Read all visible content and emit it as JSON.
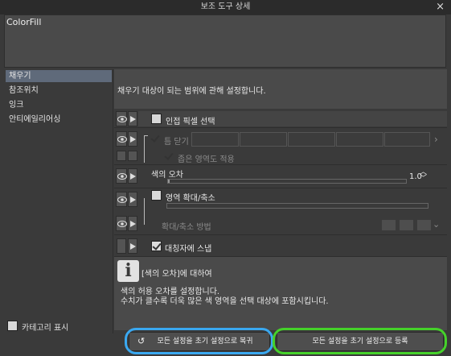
{
  "window": {
    "title": "보조 도구 상세",
    "close_label": "×"
  },
  "tool_name": "ColorFill",
  "categories": [
    {
      "label": "채우기",
      "selected": true
    },
    {
      "label": "참조위치",
      "selected": false
    },
    {
      "label": "잉크",
      "selected": false
    },
    {
      "label": "안티에일리어싱",
      "selected": false
    }
  ],
  "category_display_label": "카테고리 표시",
  "section_description": "채우기 대상이 되는 범위에 관해 설정합니다.",
  "settings": {
    "adjacent_pixels": "인접 픽셀 선택",
    "close_gap": "틈 닫기",
    "apply_narrow": "좁은 영역도 적용",
    "tolerance_label": "색의 오차",
    "tolerance_value": "1.0",
    "expand_label": "영역 확대/축소",
    "expand_method": "확대/축소 방법",
    "snap": "대칭자에 스냅"
  },
  "help": {
    "title": "[색의 오차]에 대하여",
    "line1": "색의 허용 오차를 설정합니다.",
    "line2": "수치가 클수록 더욱 많은 색 영역을 선택 대상에 포함시킵니다."
  },
  "buttons": {
    "reset": "모든 설정을 초기 설정으로 복귀",
    "register": "모든 설정을 초기 설정으로 등록"
  },
  "colors": {
    "highlight_blue": "#3aa8f0",
    "highlight_green": "#45d12a",
    "selection": "#5f6a7a"
  }
}
